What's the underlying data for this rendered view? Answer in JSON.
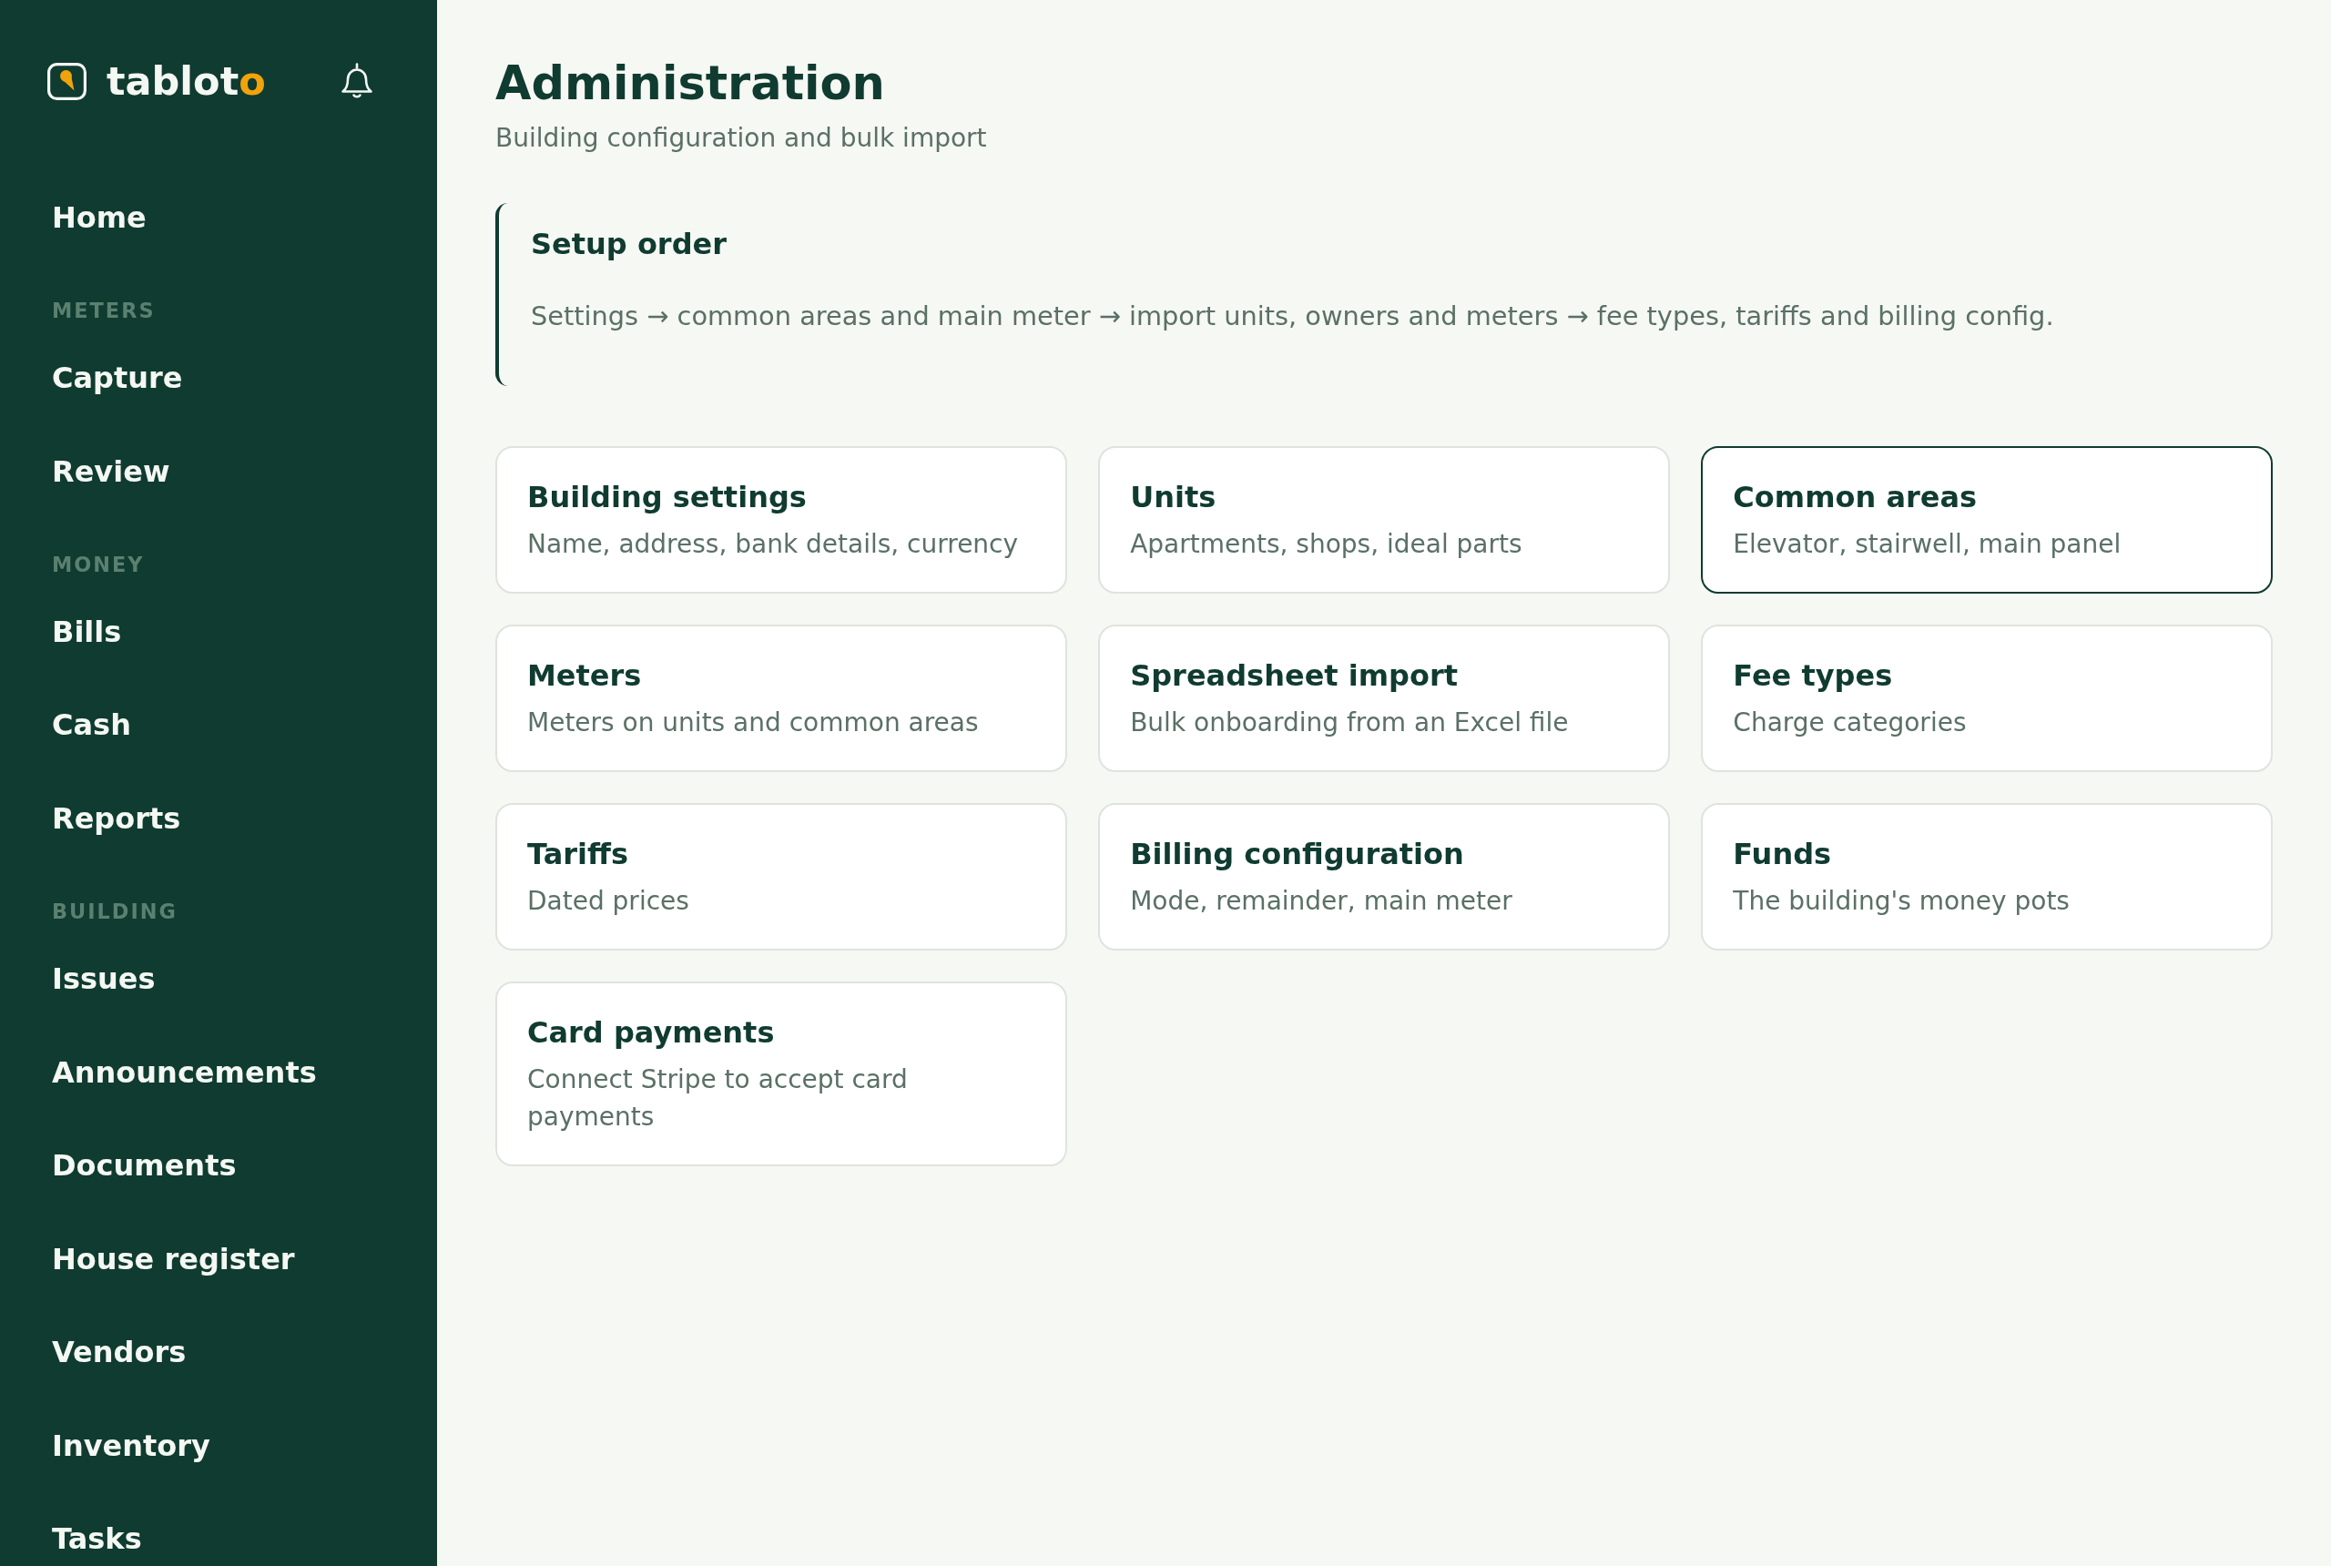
{
  "sidebar": {
    "logo": {
      "text": "tablot",
      "accent": "o"
    },
    "sections": [
      {
        "items": [
          {
            "label": "Home",
            "selected": false
          }
        ]
      },
      {
        "heading": "METERS",
        "items": [
          {
            "label": "Capture",
            "selected": false
          },
          {
            "label": "Review",
            "selected": false
          }
        ]
      },
      {
        "heading": "MONEY",
        "items": [
          {
            "label": "Bills",
            "selected": false
          },
          {
            "label": "Cash",
            "selected": false
          },
          {
            "label": "Reports",
            "selected": false
          }
        ]
      },
      {
        "heading": "BUILDING",
        "items": [
          {
            "label": "Issues",
            "selected": false
          },
          {
            "label": "Announcements",
            "selected": false
          },
          {
            "label": "Documents",
            "selected": false
          },
          {
            "label": "House register",
            "selected": false
          },
          {
            "label": "Vendors",
            "selected": false
          },
          {
            "label": "Inventory",
            "selected": false
          },
          {
            "label": "Tasks",
            "selected": false
          }
        ]
      }
    ]
  },
  "header": {
    "title": "Administration",
    "subtitle": "Building configuration and bulk import"
  },
  "setup_order": {
    "title": "Setup order",
    "text": "Settings → common areas and main meter → import units, owners and meters → fee types, tariffs and billing config."
  },
  "cards": [
    {
      "title": "Building settings",
      "description": "Name, address, bank details, currency",
      "selected": false
    },
    {
      "title": "Units",
      "description": "Apartments, shops, ideal parts",
      "selected": false
    },
    {
      "title": "Common areas",
      "description": "Elevator, stairwell, main panel",
      "selected": true
    },
    {
      "title": "Meters",
      "description": "Meters on units and common areas",
      "selected": false
    },
    {
      "title": "Spreadsheet import",
      "description": "Bulk onboarding from an Excel file",
      "selected": false
    },
    {
      "title": "Fee types",
      "description": "Charge categories",
      "selected": false
    },
    {
      "title": "Tariffs",
      "description": "Dated prices",
      "selected": false
    },
    {
      "title": "Billing configuration",
      "description": "Mode, remainder, main meter",
      "selected": false
    },
    {
      "title": "Funds",
      "description": "The building's money pots",
      "selected": false
    },
    {
      "title": "Card payments",
      "description": "Connect Stripe to accept card payments",
      "selected": false
    }
  ]
}
